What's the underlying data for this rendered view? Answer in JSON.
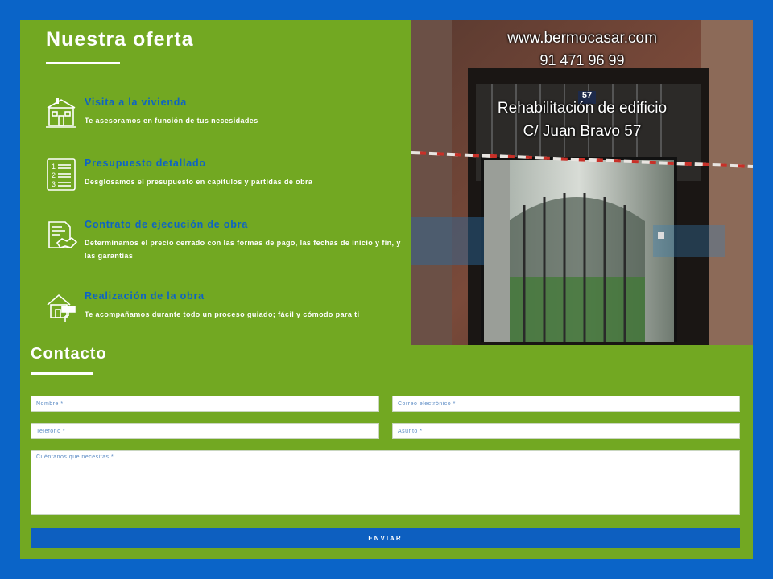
{
  "oferta": {
    "title": "Nuestra oferta",
    "items": [
      {
        "icon": "house-icon",
        "title": "Visita a la vivienda",
        "desc": "Te asesoramos en función de tus necesidades"
      },
      {
        "icon": "numbered-list-icon",
        "title": "Presupuesto detallado",
        "desc": "Desglosamos el presupuesto en capítulos y partidas de obra"
      },
      {
        "icon": "contract-handshake-icon",
        "title": "Contrato de ejecución de obra",
        "desc": "Determinamos el precio cerrado con las formas de pago, las fechas de inicio y fin, y las garantías"
      },
      {
        "icon": "house-paint-roller-icon",
        "title": "Realización de la obra",
        "desc": "Te acompañamos durante todo un proceso guiado; fácil y cómodo para ti"
      }
    ]
  },
  "photo": {
    "website": "www.bermocasar.com",
    "phone": "91 471 96 99",
    "door_number": "57",
    "caption_line1": "Rehabilitación de edificio",
    "caption_line2": "C/ Juan Bravo 57"
  },
  "contacto": {
    "title": "Contacto",
    "nombre_placeholder": "Nombre *",
    "correo_placeholder": "Correo electrónico *",
    "telefono_placeholder": "Teléfono *",
    "asunto_placeholder": "Asunto *",
    "mensaje_placeholder": "Cuéntanos que necesitas *",
    "send_label": "ENVIAR"
  },
  "colors": {
    "background": "#0a64c8",
    "panel": "#72a822",
    "accent_text": "#0d63c4",
    "button": "#0d5fc0"
  }
}
